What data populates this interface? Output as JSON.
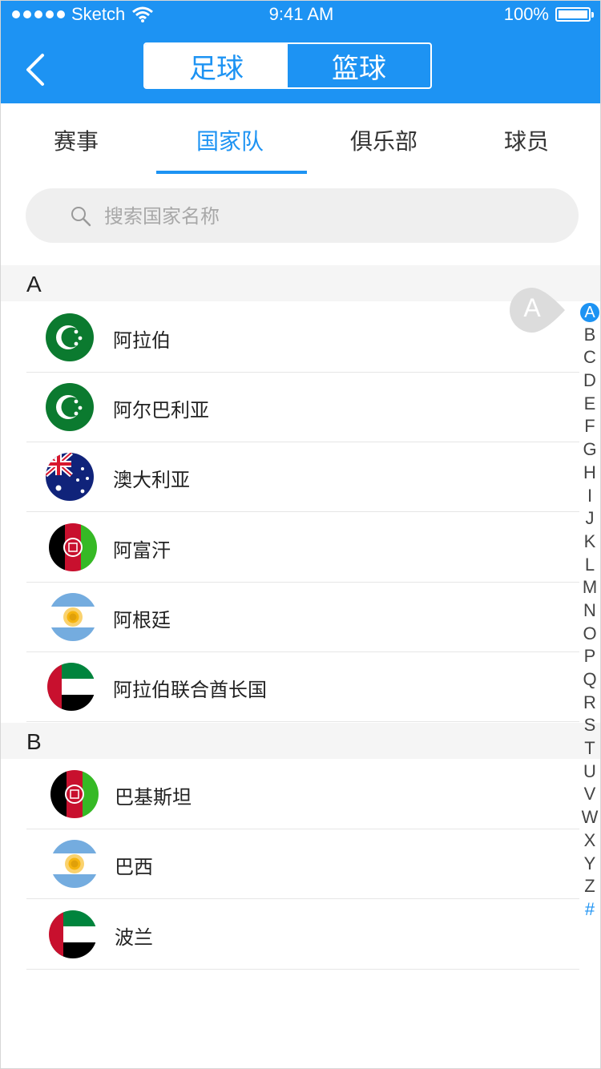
{
  "status_bar": {
    "carrier": "Sketch",
    "time": "9:41 AM",
    "battery": "100%"
  },
  "nav": {
    "segments": [
      "足球",
      "篮球"
    ],
    "active_segment": 0
  },
  "tabs": {
    "items": [
      "赛事",
      "国家队",
      "俱乐部",
      "球员"
    ],
    "active": 1
  },
  "search": {
    "placeholder": "搜索国家名称"
  },
  "sections": [
    {
      "letter": "A",
      "rows": [
        {
          "name": "阿拉伯",
          "flag": "green-crescent-flag"
        },
        {
          "name": "阿尔巴利亚",
          "flag": "green-crescent-flag"
        },
        {
          "name": "澳大利亚",
          "flag": "australia-flag"
        },
        {
          "name": "阿富汗",
          "flag": "afghanistan-flag"
        },
        {
          "name": "阿根廷",
          "flag": "argentina-flag"
        },
        {
          "name": "阿拉伯联合酋长国",
          "flag": "uae-flag"
        }
      ]
    },
    {
      "letter": "B",
      "rows": [
        {
          "name": "巴基斯坦",
          "flag": "afghanistan-flag"
        },
        {
          "name": "巴西",
          "flag": "argentina-flag"
        },
        {
          "name": "波兰",
          "flag": "uae-flag"
        }
      ]
    }
  ],
  "index_bar": {
    "letters": [
      "A",
      "B",
      "C",
      "D",
      "E",
      "F",
      "G",
      "H",
      "I",
      "J",
      "K",
      "L",
      "M",
      "N",
      "O",
      "P",
      "Q",
      "R",
      "S",
      "T",
      "U",
      "V",
      "W",
      "X",
      "Y",
      "Z",
      "#"
    ],
    "current": "A"
  },
  "colors": {
    "primary": "#1d93f3",
    "section_bg": "#f5f5f5",
    "search_bg": "#efefef"
  }
}
